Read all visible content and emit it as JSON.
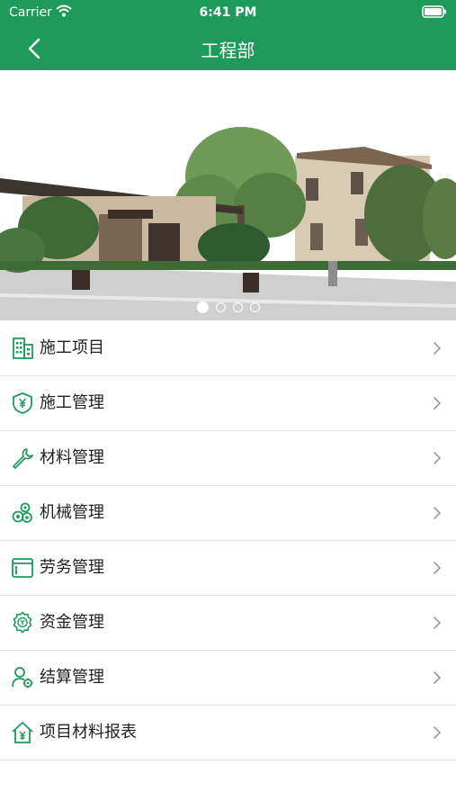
{
  "status_bar": {
    "carrier": "Carrier",
    "time": "6:41 PM"
  },
  "navbar": {
    "title": "工程部"
  },
  "banner": {
    "slide_count": 4,
    "active_slide": 1
  },
  "menu": {
    "items": [
      {
        "label": "施工项目",
        "icon": "building-icon"
      },
      {
        "label": "施工管理",
        "icon": "shield-yen-icon"
      },
      {
        "label": "材料管理",
        "icon": "wrench-icon"
      },
      {
        "label": "机械管理",
        "icon": "gears-icon"
      },
      {
        "label": "劳务管理",
        "icon": "card-icon"
      },
      {
        "label": "资金管理",
        "icon": "money-gear-icon"
      },
      {
        "label": "结算管理",
        "icon": "person-gear-icon"
      },
      {
        "label": "项目材料报表",
        "icon": "house-yen-icon"
      }
    ]
  },
  "colors": {
    "brand": "#1e9a5a",
    "icon": "#1e9a5a"
  }
}
